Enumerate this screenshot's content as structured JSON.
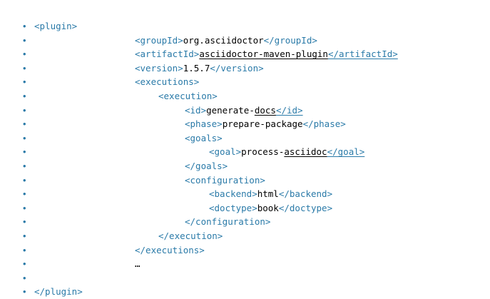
{
  "bullet_glyph": "•",
  "colors": {
    "tag": "#2a7aa8",
    "text": "#000000",
    "bullet": "#2a7aa8"
  },
  "lines": [
    {
      "indent": 0,
      "parts": [
        {
          "t": "<plugin>",
          "k": "tag"
        }
      ]
    },
    {
      "indent": 1,
      "parts": [
        {
          "t": "<groupId>",
          "k": "tag"
        },
        {
          "t": "org.asciidoctor",
          "k": "txt"
        },
        {
          "t": "</groupId>",
          "k": "tag"
        }
      ]
    },
    {
      "indent": 1,
      "parts": [
        {
          "t": "<artifactId>",
          "k": "tag"
        },
        {
          "t": "asciidoctor-maven-plugin",
          "k": "txt",
          "u": true
        },
        {
          "t": "</artifactId>",
          "k": "tag",
          "u": true
        }
      ]
    },
    {
      "indent": 1,
      "parts": [
        {
          "t": "<version>",
          "k": "tag"
        },
        {
          "t": "1.5.7",
          "k": "txt"
        },
        {
          "t": "</version>",
          "k": "tag"
        }
      ]
    },
    {
      "indent": 1,
      "parts": [
        {
          "t": "<executions>",
          "k": "tag"
        }
      ]
    },
    {
      "indent": 2,
      "parts": [
        {
          "t": "<execution>",
          "k": "tag"
        }
      ]
    },
    {
      "indent": 3,
      "parts": [
        {
          "t": "<id>",
          "k": "tag"
        },
        {
          "t": "generate-",
          "k": "txt"
        },
        {
          "t": "docs",
          "k": "txt",
          "u": true
        },
        {
          "t": "</id>",
          "k": "tag",
          "u": true
        }
      ]
    },
    {
      "indent": 3,
      "parts": [
        {
          "t": "<phase>",
          "k": "tag"
        },
        {
          "t": "prepare-package",
          "k": "txt"
        },
        {
          "t": "</phase>",
          "k": "tag"
        }
      ]
    },
    {
      "indent": 3,
      "parts": [
        {
          "t": "<goals>",
          "k": "tag"
        }
      ]
    },
    {
      "indent": 4,
      "parts": [
        {
          "t": "<goal>",
          "k": "tag"
        },
        {
          "t": "process-",
          "k": "txt"
        },
        {
          "t": "asciidoc",
          "k": "txt",
          "u": true
        },
        {
          "t": "</goal>",
          "k": "tag",
          "u": true
        }
      ]
    },
    {
      "indent": 3,
      "parts": [
        {
          "t": "</goals>",
          "k": "tag"
        }
      ]
    },
    {
      "indent": 3,
      "parts": [
        {
          "t": "<configuration>",
          "k": "tag"
        }
      ]
    },
    {
      "indent": 4,
      "parts": [
        {
          "t": "<backend>",
          "k": "tag"
        },
        {
          "t": "html",
          "k": "txt"
        },
        {
          "t": "</backend>",
          "k": "tag"
        }
      ]
    },
    {
      "indent": 4,
      "parts": [
        {
          "t": "<doctype>",
          "k": "tag"
        },
        {
          "t": "book",
          "k": "txt"
        },
        {
          "t": "</doctype>",
          "k": "tag"
        }
      ]
    },
    {
      "indent": 3,
      "parts": [
        {
          "t": "</configuration>",
          "k": "tag"
        }
      ]
    },
    {
      "indent": 2,
      "parts": [
        {
          "t": "</execution>",
          "k": "tag"
        }
      ]
    },
    {
      "indent": 1,
      "parts": [
        {
          "t": "</executions>",
          "k": "tag"
        }
      ]
    },
    {
      "indent": 1,
      "parts": [
        {
          "t": "…",
          "k": "txt"
        }
      ]
    },
    {
      "indent": 5,
      "parts": []
    },
    {
      "indent": 0,
      "parts": [
        {
          "t": "</plugin>",
          "k": "tag"
        }
      ]
    }
  ]
}
